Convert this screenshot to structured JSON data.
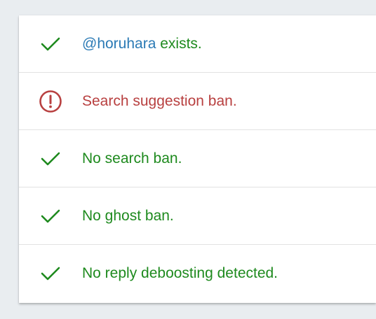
{
  "colors": {
    "ok": "#1e8a1e",
    "warn": "#b84040",
    "handle": "#2b7ab5"
  },
  "results": [
    {
      "status": "ok",
      "icon": "check-icon",
      "handle": "@horuhara",
      "text": " exists."
    },
    {
      "status": "warn",
      "icon": "alert-circle-icon",
      "text": "Search suggestion ban."
    },
    {
      "status": "ok",
      "icon": "check-icon",
      "text": "No search ban."
    },
    {
      "status": "ok",
      "icon": "check-icon",
      "text": "No ghost ban."
    },
    {
      "status": "ok",
      "icon": "check-icon",
      "text": "No reply deboosting detected."
    }
  ]
}
